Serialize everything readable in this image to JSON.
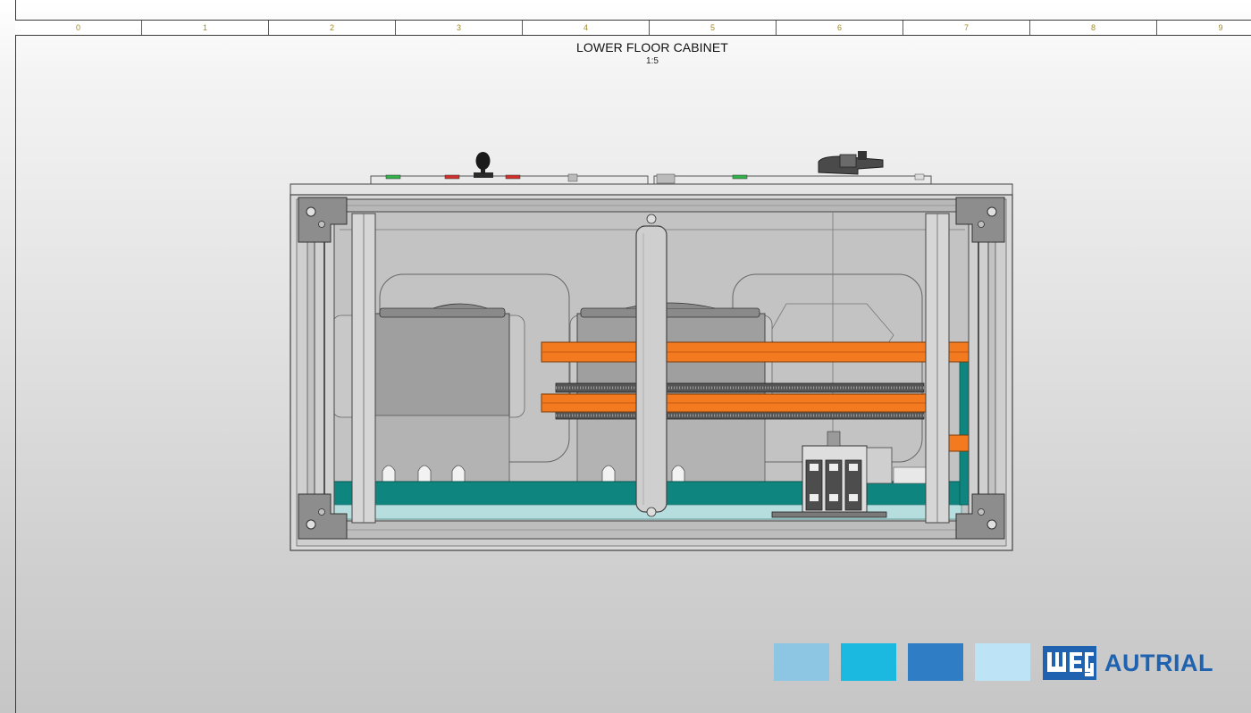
{
  "sheet": {
    "columns": [
      "0",
      "1",
      "2",
      "3",
      "4",
      "5",
      "6",
      "7",
      "8",
      "9"
    ],
    "title": "LOWER FLOOR CABINET",
    "scale": "1:5"
  },
  "brand": {
    "wordmark": "weg",
    "name": "AUTRIAL",
    "color": "#1f63b0",
    "swatches": [
      "#8cc6e2",
      "#1bb8e0",
      "#2f7dc4",
      "#bde3f6"
    ]
  },
  "colors": {
    "busbar": "#f47a1f",
    "mounting_plate": "#0f857f",
    "frame": "#d4d4d4",
    "door_glass": "#bfbfbf"
  }
}
